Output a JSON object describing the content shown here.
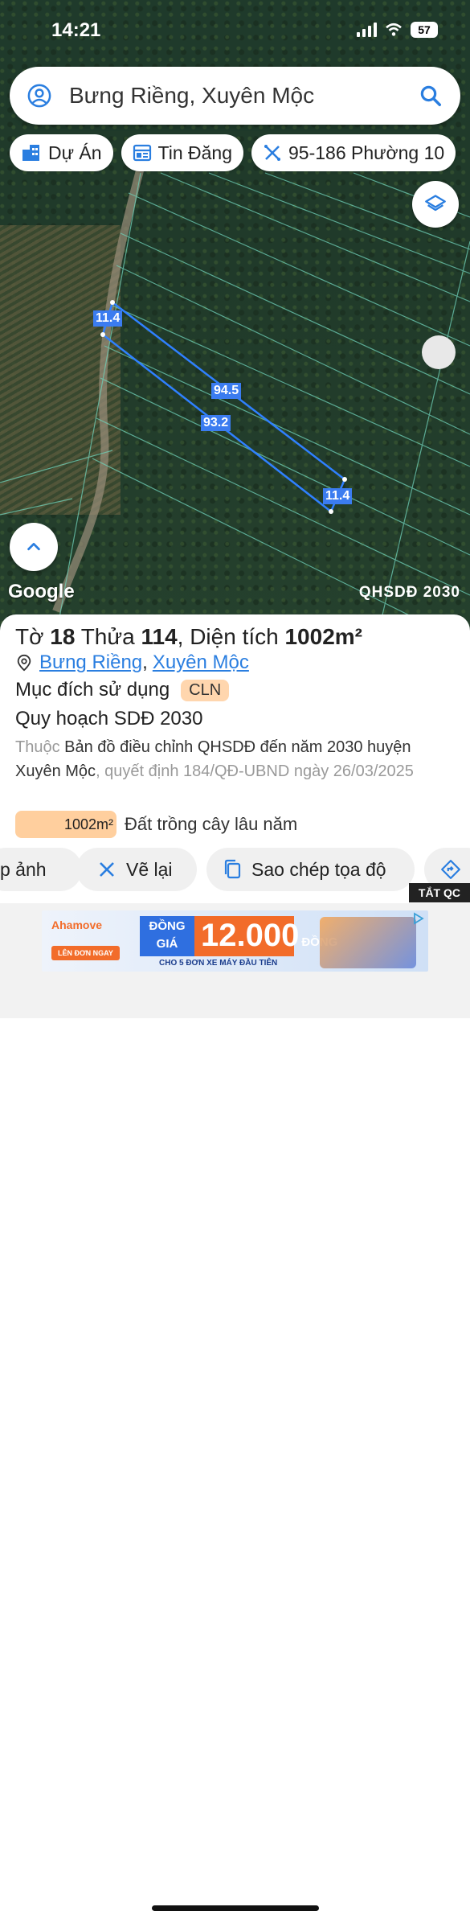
{
  "status": {
    "time": "14:21",
    "battery": "57"
  },
  "search": {
    "query": "Bưng Riềng, Xuyên Mộc"
  },
  "chips": [
    {
      "label": "Dự Án",
      "icon": "building-icon"
    },
    {
      "label": "Tin Đăng",
      "icon": "listing-icon"
    },
    {
      "label": "95-186 Phường 10",
      "icon": "measure-icon"
    }
  ],
  "map": {
    "watermark": "Google",
    "layer_label": "QHSDĐ 2030",
    "dimensions": {
      "top": "11.4",
      "long_top": "94.5",
      "long_bottom": "93.2",
      "bottom": "11.4"
    }
  },
  "parcel": {
    "sheet_label": "Tờ",
    "sheet": "18",
    "plot_label": "Thửa",
    "plot": "114",
    "area_label": "Diện tích",
    "area": "1002m²",
    "location_1": "Bưng Riềng",
    "location_sep": ",",
    "location_2": "Xuyên Mộc",
    "purpose_label": "Mục đích sử dụng",
    "purpose_code": "CLN",
    "plan_title": "Quy hoạch SDĐ 2030",
    "desc_prefix": "Thuộc",
    "desc_map": "Bản đồ điều chỉnh QHSDĐ đến năm 2030 huyện Xuyên Mộc",
    "desc_decision": ", quyết định 184/QĐ-UBND ngày 26/03/2025",
    "area_box": "1002m²",
    "land_type": "Đất trồng cây lâu năm"
  },
  "actions": {
    "photo": "p ảnh",
    "redraw": "Vẽ lại",
    "copy": "Sao chép tọa độ"
  },
  "ad": {
    "close_label": "TẮT QC",
    "brand": "Ahamove",
    "cta": "LÊN ĐƠN NGAY",
    "line1": "ĐỒNG",
    "line2": "GIÁ",
    "price": "12.000",
    "currency": "ĐỒNG",
    "subtitle": "CHO 5 ĐƠN XE MÁY ĐẦU TIÊN"
  }
}
